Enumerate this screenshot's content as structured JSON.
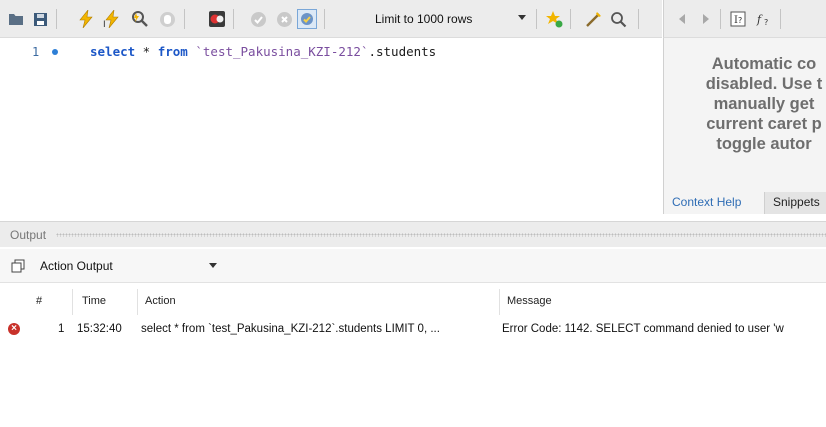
{
  "toolbar": {
    "limit_label": "Limit to 1000 rows",
    "icons": [
      "open-folder-icon",
      "save-icon",
      "execute-icon",
      "execute-statement-icon",
      "explain-icon",
      "stop-icon",
      "toggle-error-icon",
      "commit-icon",
      "rollback-icon",
      "autocommit-icon",
      "favorite-add-icon",
      "beautify-icon",
      "find-icon"
    ],
    "right_icons": [
      "back-arrow-icon",
      "forward-arrow-icon",
      "context-help-icon",
      "snippet-icon"
    ]
  },
  "editor": {
    "line_number": "1",
    "code_tokens": {
      "kw1": "select",
      "star": " * ",
      "kw2": "from",
      "space": " ",
      "schema": "`test_Pakusina_KZI-212`",
      "table": ".students"
    }
  },
  "help_panel": {
    "lines": [
      "Automatic co",
      "disabled. Use t",
      "manually get",
      "current caret p",
      "toggle autor"
    ],
    "tabs": {
      "help": "Context Help",
      "snippets": "Snippets"
    }
  },
  "output": {
    "title": "Output",
    "selector_value": "Action Output",
    "columns": {
      "num": "#",
      "time": "Time",
      "action": "Action",
      "message": "Message"
    },
    "rows": [
      {
        "num": "1",
        "time": "15:32:40",
        "action": "select * from `test_Pakusina_KZI-212`.students LIMIT 0, ...",
        "message": "Error Code: 1142. SELECT command denied to user 'w"
      }
    ]
  },
  "colors": {
    "keyword": "#1c57c7",
    "error": "#c8312a",
    "link": "#2f6db5"
  }
}
